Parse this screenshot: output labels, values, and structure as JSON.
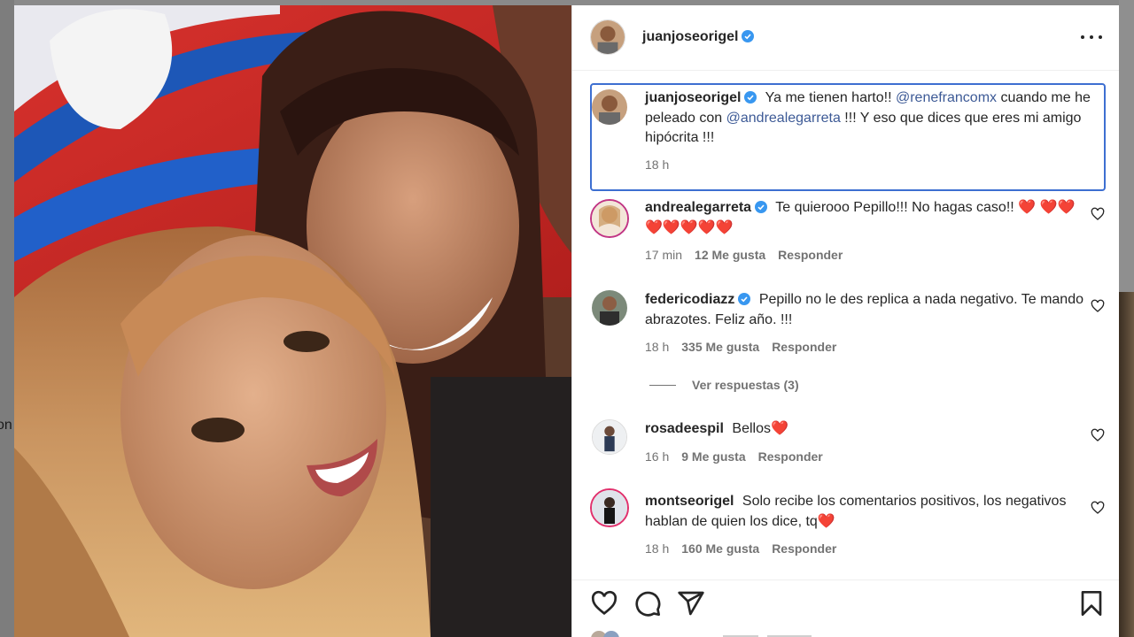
{
  "backdrop": {
    "left_text": "on"
  },
  "post": {
    "author": "juanjoseorigel",
    "verified": true
  },
  "caption": {
    "username": "juanjoseorigel",
    "text_parts": [
      "Ya me tienen harto!! ",
      "@renefrancomx",
      " cuando me he peleado con ",
      "@andrealegarreta",
      " !!! Y eso que dices que eres mi amigo hipócrita !!!"
    ],
    "time": "18 h"
  },
  "comments": [
    {
      "username": "andrealegarreta",
      "verified": true,
      "text": "Te quierooo Pepillo!!! No hagas caso!! ❤️ ❤️❤️❤️❤️❤️❤️❤️",
      "time": "17 min",
      "likes": "12 Me gusta",
      "reply": "Responder"
    },
    {
      "username": "federicodiazz",
      "verified": true,
      "text": "Pepillo no le des replica a nada negativo. Te mando abrazotes. Feliz año. !!!",
      "time": "18 h",
      "likes": "335 Me gusta",
      "reply": "Responder"
    },
    {
      "username": "rosadeespil",
      "verified": false,
      "text": "Bellos❤️",
      "time": "16 h",
      "likes": "9 Me gusta",
      "reply": "Responder"
    },
    {
      "username": "montseorigel",
      "verified": false,
      "text": "Solo recibe los comentarios positivos, los negativos hablan de quien los dice, tq❤️",
      "time": "18 h",
      "likes": "160 Me gusta",
      "reply": "Responder"
    }
  ],
  "view_replies": "Ver respuestas (3)",
  "icons": {
    "more": "more-options-icon",
    "like": "heart-outline-icon",
    "comment": "comment-bubble-icon",
    "share": "paper-plane-icon",
    "save": "bookmark-icon",
    "verified": "verified-badge-icon"
  },
  "colors": {
    "verified": "#3897f0",
    "mention": "#3d5a96",
    "highlight_border": "#3d6fd1",
    "muted": "#737373"
  }
}
